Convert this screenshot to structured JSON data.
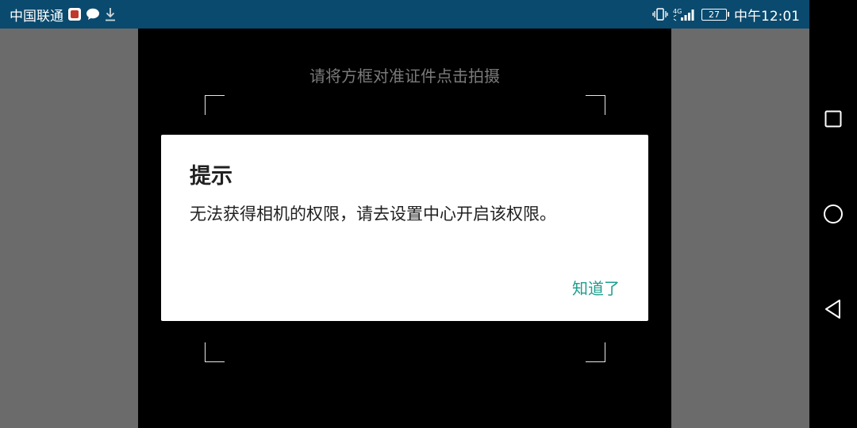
{
  "status_bar": {
    "carrier": "中国联通",
    "network_type": "4G",
    "battery_level": "27",
    "time": "中午12:01",
    "icons": [
      "app-badge-icon",
      "chat-icon",
      "download-icon",
      "vibrate-icon",
      "signal-icon",
      "battery-icon"
    ]
  },
  "camera": {
    "hint": "请将方框对准证件点击拍摄"
  },
  "dialog": {
    "title": "提示",
    "message": "无法获得相机的权限，请去设置中心开启该权限。",
    "confirm_label": "知道了"
  },
  "navigation": {
    "icons": [
      "recent-apps-icon",
      "home-icon",
      "back-icon"
    ]
  },
  "colors": {
    "status_bar": "#0a4a6e",
    "accent": "#1e9e8e",
    "dialog_bg": "#ffffff",
    "camera_bg": "#000000",
    "side_bg": "#6b6b6b"
  }
}
